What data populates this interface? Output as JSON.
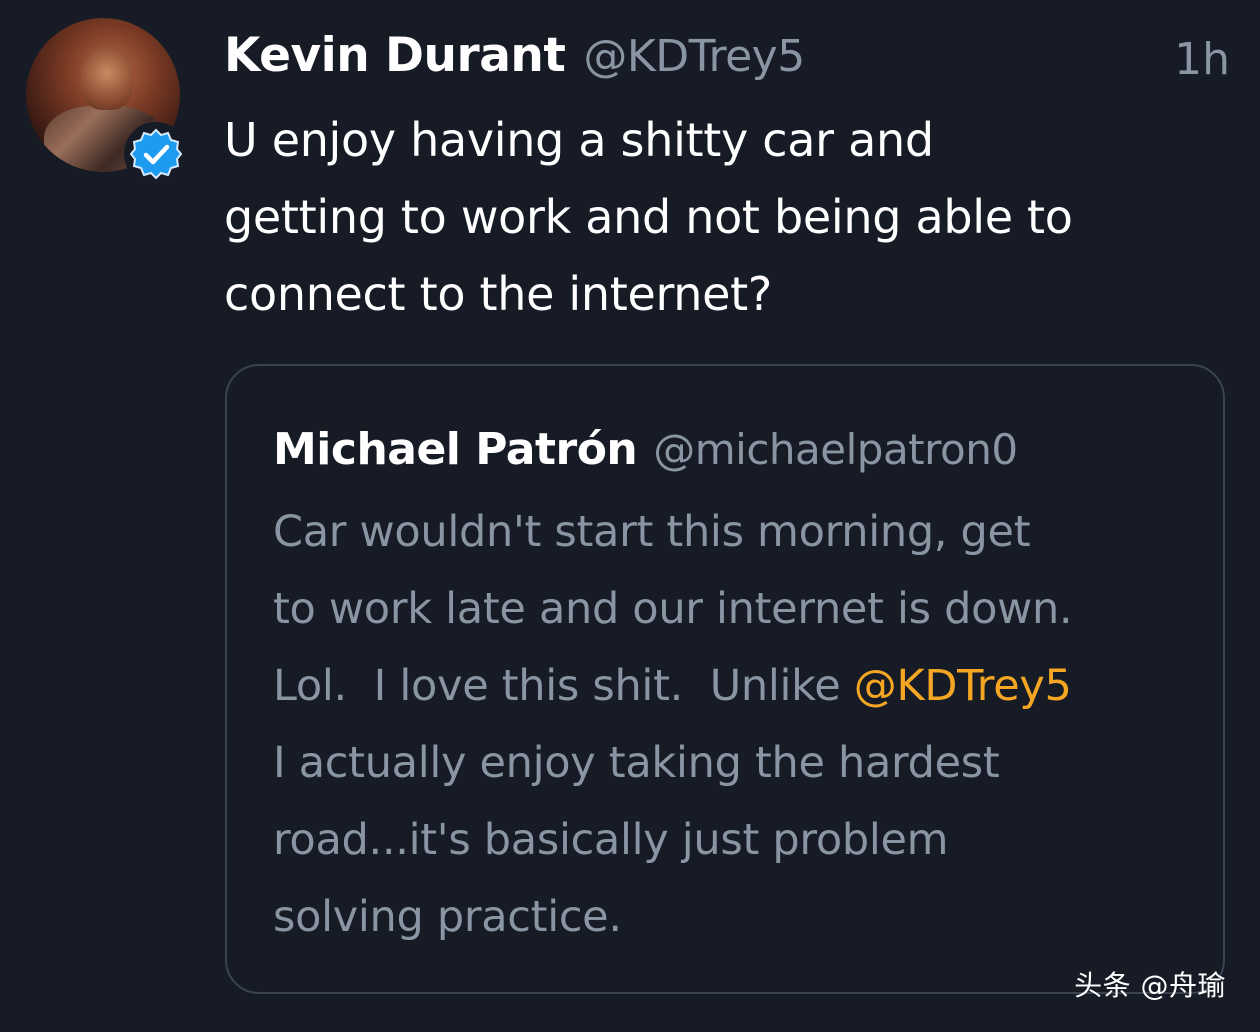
{
  "tweet": {
    "author_name": "Kevin Durant",
    "author_handle": "@KDTrey5",
    "time": "1h",
    "text_line1": "U enjoy having a shitty car and",
    "text_line2": "getting to work and not being able to",
    "text_line3": "connect to the internet?",
    "verified_icon": "verified-check-icon"
  },
  "quoted": {
    "author_name": "Michael Patrón",
    "author_handle": "@michaelpatron0",
    "line1": "Car wouldn't start this morning, get",
    "line2": "to work late and our internet is down.",
    "line3_before": "Lol.  I love this shit.  Unlike ",
    "mention": "@KDTrey5",
    "line4": "I actually enjoy taking the hardest",
    "line5": "road...it's basically just problem",
    "line6": "solving practice."
  },
  "watermark": "头条 @舟瑜",
  "colors": {
    "background": "#161b26",
    "primary_text": "#ffffff",
    "secondary_text": "#8a95a3",
    "mention": "#f5a623",
    "verified_blue": "#1d9bf0",
    "quote_border": "#3a4350"
  }
}
